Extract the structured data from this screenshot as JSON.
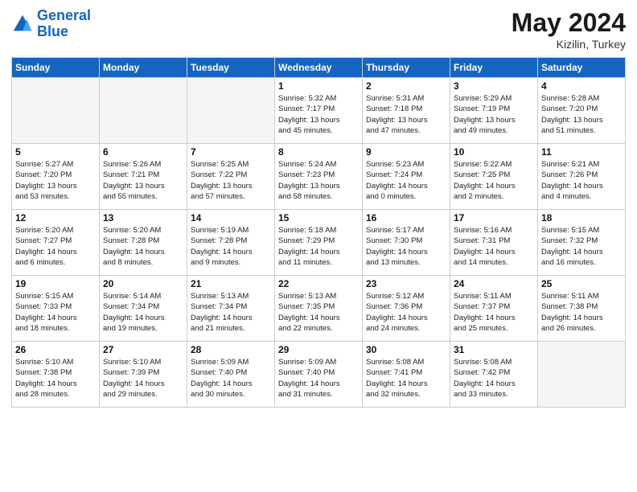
{
  "header": {
    "logo_line1": "General",
    "logo_line2": "Blue",
    "month_year": "May 2024",
    "location": "Kizilin, Turkey"
  },
  "weekdays": [
    "Sunday",
    "Monday",
    "Tuesday",
    "Wednesday",
    "Thursday",
    "Friday",
    "Saturday"
  ],
  "weeks": [
    [
      {
        "day": "",
        "info": ""
      },
      {
        "day": "",
        "info": ""
      },
      {
        "day": "",
        "info": ""
      },
      {
        "day": "1",
        "info": "Sunrise: 5:32 AM\nSunset: 7:17 PM\nDaylight: 13 hours\nand 45 minutes."
      },
      {
        "day": "2",
        "info": "Sunrise: 5:31 AM\nSunset: 7:18 PM\nDaylight: 13 hours\nand 47 minutes."
      },
      {
        "day": "3",
        "info": "Sunrise: 5:29 AM\nSunset: 7:19 PM\nDaylight: 13 hours\nand 49 minutes."
      },
      {
        "day": "4",
        "info": "Sunrise: 5:28 AM\nSunset: 7:20 PM\nDaylight: 13 hours\nand 51 minutes."
      }
    ],
    [
      {
        "day": "5",
        "info": "Sunrise: 5:27 AM\nSunset: 7:20 PM\nDaylight: 13 hours\nand 53 minutes."
      },
      {
        "day": "6",
        "info": "Sunrise: 5:26 AM\nSunset: 7:21 PM\nDaylight: 13 hours\nand 55 minutes."
      },
      {
        "day": "7",
        "info": "Sunrise: 5:25 AM\nSunset: 7:22 PM\nDaylight: 13 hours\nand 57 minutes."
      },
      {
        "day": "8",
        "info": "Sunrise: 5:24 AM\nSunset: 7:23 PM\nDaylight: 13 hours\nand 58 minutes."
      },
      {
        "day": "9",
        "info": "Sunrise: 5:23 AM\nSunset: 7:24 PM\nDaylight: 14 hours\nand 0 minutes."
      },
      {
        "day": "10",
        "info": "Sunrise: 5:22 AM\nSunset: 7:25 PM\nDaylight: 14 hours\nand 2 minutes."
      },
      {
        "day": "11",
        "info": "Sunrise: 5:21 AM\nSunset: 7:26 PM\nDaylight: 14 hours\nand 4 minutes."
      }
    ],
    [
      {
        "day": "12",
        "info": "Sunrise: 5:20 AM\nSunset: 7:27 PM\nDaylight: 14 hours\nand 6 minutes."
      },
      {
        "day": "13",
        "info": "Sunrise: 5:20 AM\nSunset: 7:28 PM\nDaylight: 14 hours\nand 8 minutes."
      },
      {
        "day": "14",
        "info": "Sunrise: 5:19 AM\nSunset: 7:28 PM\nDaylight: 14 hours\nand 9 minutes."
      },
      {
        "day": "15",
        "info": "Sunrise: 5:18 AM\nSunset: 7:29 PM\nDaylight: 14 hours\nand 11 minutes."
      },
      {
        "day": "16",
        "info": "Sunrise: 5:17 AM\nSunset: 7:30 PM\nDaylight: 14 hours\nand 13 minutes."
      },
      {
        "day": "17",
        "info": "Sunrise: 5:16 AM\nSunset: 7:31 PM\nDaylight: 14 hours\nand 14 minutes."
      },
      {
        "day": "18",
        "info": "Sunrise: 5:15 AM\nSunset: 7:32 PM\nDaylight: 14 hours\nand 16 minutes."
      }
    ],
    [
      {
        "day": "19",
        "info": "Sunrise: 5:15 AM\nSunset: 7:33 PM\nDaylight: 14 hours\nand 18 minutes."
      },
      {
        "day": "20",
        "info": "Sunrise: 5:14 AM\nSunset: 7:34 PM\nDaylight: 14 hours\nand 19 minutes."
      },
      {
        "day": "21",
        "info": "Sunrise: 5:13 AM\nSunset: 7:34 PM\nDaylight: 14 hours\nand 21 minutes."
      },
      {
        "day": "22",
        "info": "Sunrise: 5:13 AM\nSunset: 7:35 PM\nDaylight: 14 hours\nand 22 minutes."
      },
      {
        "day": "23",
        "info": "Sunrise: 5:12 AM\nSunset: 7:36 PM\nDaylight: 14 hours\nand 24 minutes."
      },
      {
        "day": "24",
        "info": "Sunrise: 5:11 AM\nSunset: 7:37 PM\nDaylight: 14 hours\nand 25 minutes."
      },
      {
        "day": "25",
        "info": "Sunrise: 5:11 AM\nSunset: 7:38 PM\nDaylight: 14 hours\nand 26 minutes."
      }
    ],
    [
      {
        "day": "26",
        "info": "Sunrise: 5:10 AM\nSunset: 7:38 PM\nDaylight: 14 hours\nand 28 minutes."
      },
      {
        "day": "27",
        "info": "Sunrise: 5:10 AM\nSunset: 7:39 PM\nDaylight: 14 hours\nand 29 minutes."
      },
      {
        "day": "28",
        "info": "Sunrise: 5:09 AM\nSunset: 7:40 PM\nDaylight: 14 hours\nand 30 minutes."
      },
      {
        "day": "29",
        "info": "Sunrise: 5:09 AM\nSunset: 7:40 PM\nDaylight: 14 hours\nand 31 minutes."
      },
      {
        "day": "30",
        "info": "Sunrise: 5:08 AM\nSunset: 7:41 PM\nDaylight: 14 hours\nand 32 minutes."
      },
      {
        "day": "31",
        "info": "Sunrise: 5:08 AM\nSunset: 7:42 PM\nDaylight: 14 hours\nand 33 minutes."
      },
      {
        "day": "",
        "info": ""
      }
    ]
  ]
}
